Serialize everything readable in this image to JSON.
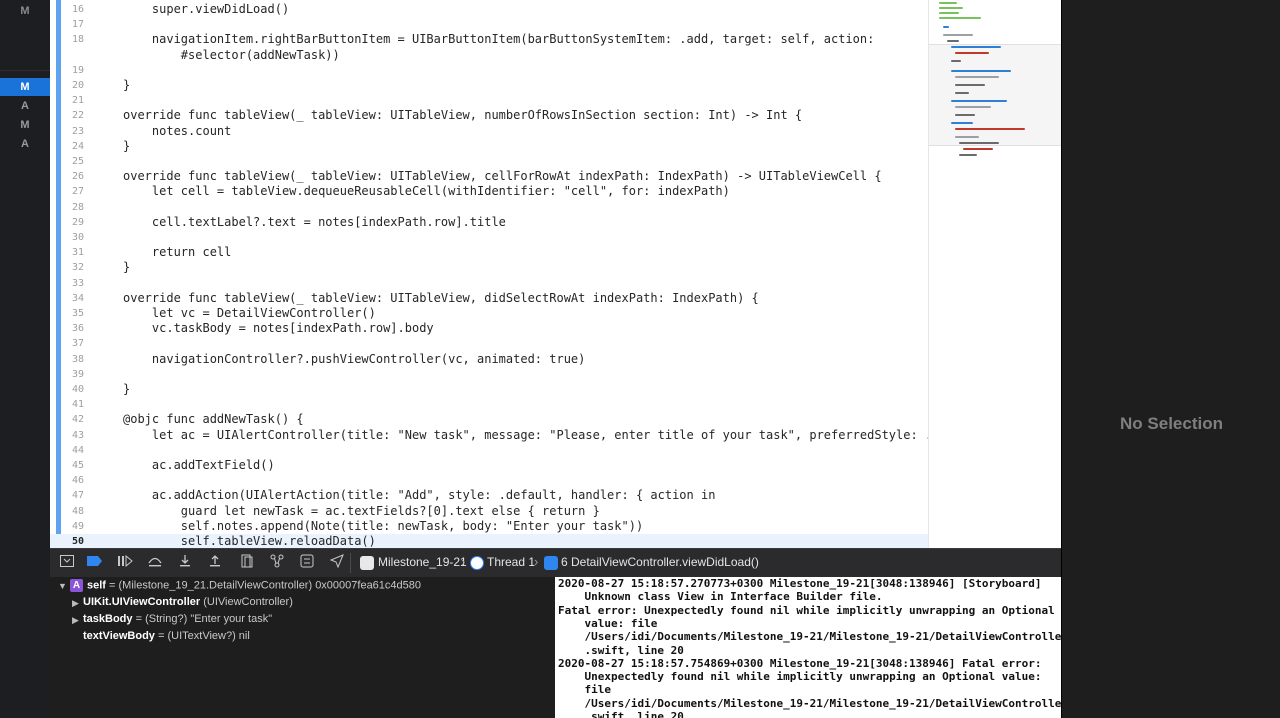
{
  "sidebar": {
    "top_status": "M",
    "statuses": [
      {
        "label": "M",
        "selected": true
      },
      {
        "label": "A",
        "selected": false
      },
      {
        "label": "M",
        "selected": false
      },
      {
        "label": "A",
        "selected": false
      }
    ]
  },
  "editor": {
    "current_line": "50",
    "lines": [
      {
        "num": "16",
        "text": "    super.viewDidLoad()"
      },
      {
        "num": "17",
        "text": ""
      },
      {
        "num": "18",
        "text": "    navigationItem.rightBarButtonItem = UIBarButtonItem(barButtonSystemItem: .add, target: self, action:"
      },
      {
        "num": "",
        "text": "        #selector(addNewTask))"
      },
      {
        "num": "19",
        "text": ""
      },
      {
        "num": "20",
        "text": "}"
      },
      {
        "num": "21",
        "text": ""
      },
      {
        "num": "22",
        "text": "override func tableView(_ tableView: UITableView, numberOfRowsInSection section: Int) -> Int {"
      },
      {
        "num": "23",
        "text": "    notes.count"
      },
      {
        "num": "24",
        "text": "}"
      },
      {
        "num": "25",
        "text": ""
      },
      {
        "num": "26",
        "text": "override func tableView(_ tableView: UITableView, cellForRowAt indexPath: IndexPath) -> UITableViewCell {"
      },
      {
        "num": "27",
        "text": "    let cell = tableView.dequeueReusableCell(withIdentifier: \"cell\", for: indexPath)"
      },
      {
        "num": "28",
        "text": ""
      },
      {
        "num": "29",
        "text": "    cell.textLabel?.text = notes[indexPath.row].title"
      },
      {
        "num": "30",
        "text": ""
      },
      {
        "num": "31",
        "text": "    return cell"
      },
      {
        "num": "32",
        "text": "}"
      },
      {
        "num": "33",
        "text": ""
      },
      {
        "num": "34",
        "text": "override func tableView(_ tableView: UITableView, didSelectRowAt indexPath: IndexPath) {"
      },
      {
        "num": "35",
        "text": "    let vc = DetailViewController()"
      },
      {
        "num": "36",
        "text": "    vc.taskBody = notes[indexPath.row].body"
      },
      {
        "num": "37",
        "text": ""
      },
      {
        "num": "38",
        "text": "    navigationController?.pushViewController(vc, animated: true)"
      },
      {
        "num": "39",
        "text": ""
      },
      {
        "num": "40",
        "text": "}"
      },
      {
        "num": "41",
        "text": ""
      },
      {
        "num": "42",
        "text": "@objc func addNewTask() {"
      },
      {
        "num": "43",
        "text": "    let ac = UIAlertController(title: \"New task\", message: \"Please, enter title of your task\", preferredStyle: .alert)"
      },
      {
        "num": "44",
        "text": ""
      },
      {
        "num": "45",
        "text": "    ac.addTextField()"
      },
      {
        "num": "46",
        "text": ""
      },
      {
        "num": "47",
        "text": "    ac.addAction(UIAlertAction(title: \"Add\", style: .default, handler: { action in"
      },
      {
        "num": "48",
        "text": "        guard let newTask = ac.textFields?[0].text else { return }"
      },
      {
        "num": "49",
        "text": "        self.notes.append(Note(title: newTask, body: \"Enter your task\"))"
      },
      {
        "num": "50",
        "text": "        self.tableView.reloadData()"
      }
    ]
  },
  "inspector": {
    "empty_text": "No Selection"
  },
  "debug_bar": {
    "breadcrumbs": [
      "Milestone_19-21",
      "Thread 1",
      "6 DetailViewController.viewDidLoad()"
    ]
  },
  "variables": [
    {
      "badge": "A",
      "name": "self",
      "value": "(Milestone_19_21.DetailViewController) 0x00007fea61c4d580",
      "expanded": true
    },
    {
      "badge": "",
      "name": "UIKit.UIViewController",
      "value": "(UIViewController)",
      "expanded": false
    },
    {
      "badge": "",
      "name": "taskBody",
      "value": "(String?) \"Enter your task\"",
      "expanded": false
    },
    {
      "badge": "",
      "name": "textViewBody",
      "value": "(UITextView?) nil",
      "expanded": null
    }
  ],
  "console": {
    "lines": [
      "2020-08-27 15:18:57.270773+0300 Milestone_19-21[3048:138946] [Storyboard]",
      "    Unknown class View in Interface Builder file.",
      "Fatal error: Unexpectedly found nil while implicitly unwrapping an Optional",
      "    value: file",
      "    /Users/idi/Documents/Milestone_19-21/Milestone_19-21/DetailViewController",
      "    .swift, line 20",
      "2020-08-27 15:18:57.754869+0300 Milestone_19-21[3048:138946] Fatal error:",
      "    Unexpectedly found nil while implicitly unwrapping an Optional value:",
      "    file",
      "    /Users/idi/Documents/Milestone_19-21/Milestone_19-21/DetailViewController",
      "    .swift, line 20"
    ]
  },
  "colors": {
    "accent": "#1a73d9",
    "current_line_bg": "#e9f2fd",
    "change_bar": "#5ea2f0"
  }
}
